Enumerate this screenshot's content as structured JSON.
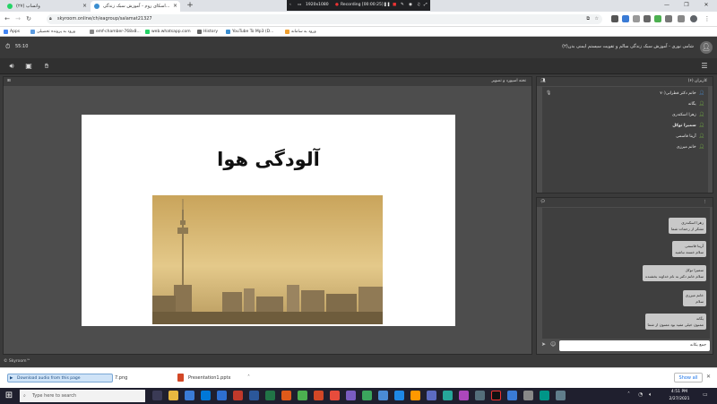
{
  "browser": {
    "tabs": [
      {
        "label": "(۲۷) واتساپ",
        "color": "#25d366"
      },
      {
        "label": "اسکای روم - آموزش سبک زندگی...",
        "color": "#3b8ed0",
        "active": true
      }
    ],
    "new_tab": "+",
    "recording_overlay": {
      "resolution": "1920x1080",
      "status": "Recording [00:00:25]"
    },
    "url": "skyroom.online/ch/eagroup/salamat21327",
    "bookmarks": [
      {
        "label": "Apps",
        "color": "#4285f4"
      },
      {
        "label": "ورود به پرونده تحصیلی",
        "color": "#5c9be0"
      },
      {
        "label": "emf-chamber-768x8...",
        "color": "#888888"
      },
      {
        "label": "web.whatsapp.com",
        "color": "#25d366"
      },
      {
        "label": "History",
        "color": "#666666"
      },
      {
        "label": "YouTube To Mp3 (D...",
        "color": "#3b8ed0"
      },
      {
        "label": "ورود به سامانه",
        "color": "#f0a030"
      }
    ],
    "window_controls": {
      "minimize": "—",
      "maximize": "❐",
      "close": "✕"
    }
  },
  "app": {
    "timer": "55:10",
    "room_title": "شامی نوری - آموزش سبک زندگی سالم و تقویت سیستم ایمنی بدن(۲)",
    "stage_title": "تخته اسپورد و تصویر",
    "slide": {
      "title": "آلودگی هوا",
      "image_alt": "تهران در آلودگی هوا"
    },
    "users_panel_title": "کاربران (۶)",
    "users": [
      {
        "name": "خانم دکتر قطرانی(۷۰",
        "color": "#4a90d9"
      },
      {
        "name": "یگانه",
        "color": "#7bc043"
      },
      {
        "name": "زهرا اسکندری",
        "color": "#7bc043"
      },
      {
        "name": "سمیرا توکل",
        "color": "#7bc043"
      },
      {
        "name": "آرینا قاسمی",
        "color": "#7bc043"
      },
      {
        "name": "خانم میرزی",
        "color": "#7bc043"
      }
    ],
    "messages": [
      {
        "name": "زهرا اسکندری",
        "text": "تشکر از زحمات شما"
      },
      {
        "name": "آرینا قاسمی",
        "text": "سلام خسته نباشید"
      },
      {
        "name": "سمیرا توکل",
        "text": "سلام خانم دکتر به نام خداوند بخشنده"
      },
      {
        "name": "خانم میرزی",
        "text": "سلام"
      },
      {
        "name": "یگانه",
        "text": "ممنون خیلی مفید بود ممنون از شما"
      }
    ],
    "chat_input_placeholder": "جمع یکانه",
    "footer": "© Skyroom™"
  },
  "downloads": {
    "notice": "Download audio from this page",
    "item1": "7.png",
    "item2": "Presentation1.pptx",
    "show_all": "Show all"
  },
  "taskbar": {
    "search_placeholder": "Type here to search",
    "time": "4:51 PM",
    "date": "2/27/2021"
  }
}
